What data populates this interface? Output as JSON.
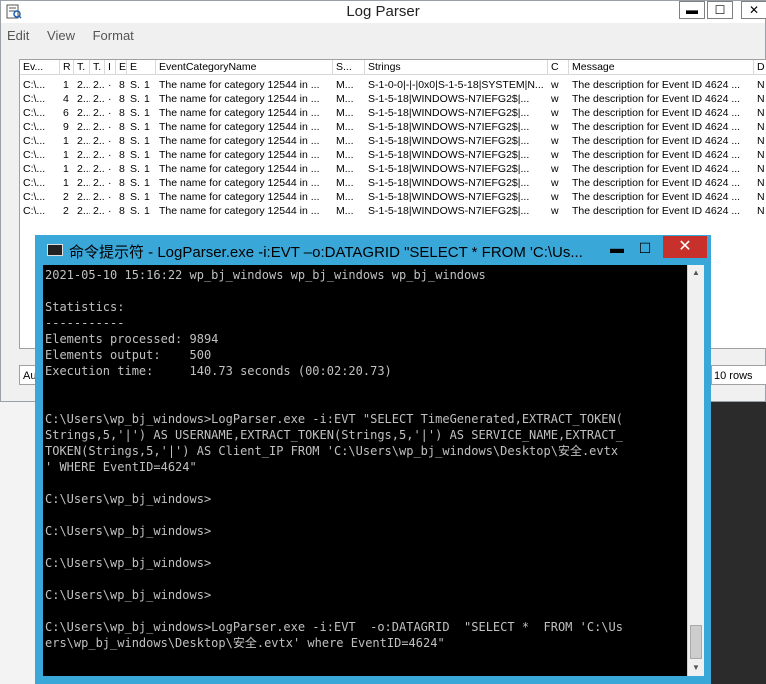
{
  "logparser": {
    "title": "Log Parser",
    "menu": [
      "Edit",
      "View",
      "Format"
    ],
    "window_buttons": {
      "minimize": "▬",
      "maximize": "☐",
      "close": "✕"
    },
    "columns": [
      "Ev...",
      "R",
      "T.",
      "T.",
      "I",
      "E",
      "E",
      "EventCategoryName",
      "S...",
      "Strings",
      "C",
      "Message",
      "D"
    ],
    "rows": [
      [
        "C:\\...",
        "1",
        "2...",
        "2...",
        "·",
        "8",
        "S.",
        "1",
        "The name for category 12544 in ...",
        "M...",
        "S-1-0-0|-|-|0x0|S-1-5-18|SYSTEM|N...",
        "w",
        "The description for Event ID 4624 ...",
        "N"
      ],
      [
        "C:\\...",
        "4",
        "2...",
        "2...",
        "·",
        "8",
        "S.",
        "1",
        "The name for category 12544 in ...",
        "M...",
        "S-1-5-18|WINDOWS-N7IEFG2$|...",
        "w",
        "The description for Event ID 4624 ...",
        "N"
      ],
      [
        "C:\\...",
        "6",
        "2...",
        "2...",
        "·",
        "8",
        "S.",
        "1",
        "The name for category 12544 in ...",
        "M...",
        "S-1-5-18|WINDOWS-N7IEFG2$|...",
        "w",
        "The description for Event ID 4624 ...",
        "N"
      ],
      [
        "C:\\...",
        "9",
        "2...",
        "2...",
        "·",
        "8",
        "S.",
        "1",
        "The name for category 12544 in ...",
        "M...",
        "S-1-5-18|WINDOWS-N7IEFG2$|...",
        "w",
        "The description for Event ID 4624 ...",
        "N"
      ],
      [
        "C:\\...",
        "1",
        "2...",
        "2...",
        "·",
        "8",
        "S.",
        "1",
        "The name for category 12544 in ...",
        "M...",
        "S-1-5-18|WINDOWS-N7IEFG2$|...",
        "w",
        "The description for Event ID 4624 ...",
        "N"
      ],
      [
        "C:\\...",
        "1",
        "2...",
        "2...",
        "·",
        "8",
        "S.",
        "1",
        "The name for category 12544 in ...",
        "M...",
        "S-1-5-18|WINDOWS-N7IEFG2$|...",
        "w",
        "The description for Event ID 4624 ...",
        "N"
      ],
      [
        "C:\\...",
        "1",
        "2...",
        "2...",
        "·",
        "8",
        "S.",
        "1",
        "The name for category 12544 in ...",
        "M...",
        "S-1-5-18|WINDOWS-N7IEFG2$|...",
        "w",
        "The description for Event ID 4624 ...",
        "N"
      ],
      [
        "C:\\...",
        "1",
        "2...",
        "2...",
        "·",
        "8",
        "S.",
        "1",
        "The name for category 12544 in ...",
        "M...",
        "S-1-5-18|WINDOWS-N7IEFG2$|...",
        "w",
        "The description for Event ID 4624 ...",
        "N"
      ],
      [
        "C:\\...",
        "2",
        "2...",
        "2...",
        "·",
        "8",
        "S.",
        "1",
        "The name for category 12544 in ...",
        "M...",
        "S-1-5-18|WINDOWS-N7IEFG2$|...",
        "w",
        "The description for Event ID 4624 ...",
        "N"
      ],
      [
        "C:\\...",
        "2",
        "2...",
        "2...",
        "·",
        "8",
        "S.",
        "1",
        "The name for category 12544 in ...",
        "M...",
        "S-1-5-18|WINDOWS-N7IEFG2$|...",
        "w",
        "The description for Event ID 4624 ...",
        "N"
      ]
    ],
    "status_left": "Au",
    "status_right": "10 rows"
  },
  "cmd": {
    "title": "命令提示符 - LogParser.exe  -i:EVT –o:DATAGRID  \"SELECT * FROM 'C:\\Us...",
    "buttons": {
      "minimize": "▬",
      "maximize": "☐",
      "close": "✕"
    },
    "lines": [
      "2021-05-10 15:16:22 wp_bj_windows wp_bj_windows wp_bj_windows",
      "",
      "Statistics:",
      "-----------",
      "Elements processed: 9894",
      "Elements output:    500",
      "Execution time:     140.73 seconds (00:02:20.73)",
      "",
      "",
      "C:\\Users\\wp_bj_windows>LogParser.exe -i:EVT \"SELECT TimeGenerated,EXTRACT_TOKEN(",
      "Strings,5,'|') AS USERNAME,EXTRACT_TOKEN(Strings,5,'|') AS SERVICE_NAME,EXTRACT_",
      "TOKEN(Strings,5,'|') AS Client_IP FROM 'C:\\Users\\wp_bj_windows\\Desktop\\安全.evtx",
      "' WHERE EventID=4624\"",
      "",
      "C:\\Users\\wp_bj_windows>",
      "",
      "C:\\Users\\wp_bj_windows>",
      "",
      "C:\\Users\\wp_bj_windows>",
      "",
      "C:\\Users\\wp_bj_windows>",
      "",
      "C:\\Users\\wp_bj_windows>LogParser.exe -i:EVT  -o:DATAGRID  \"SELECT *  FROM 'C:\\Us",
      "ers\\wp_bj_windows\\Desktop\\安全.evtx' where EventID=4624\""
    ]
  }
}
